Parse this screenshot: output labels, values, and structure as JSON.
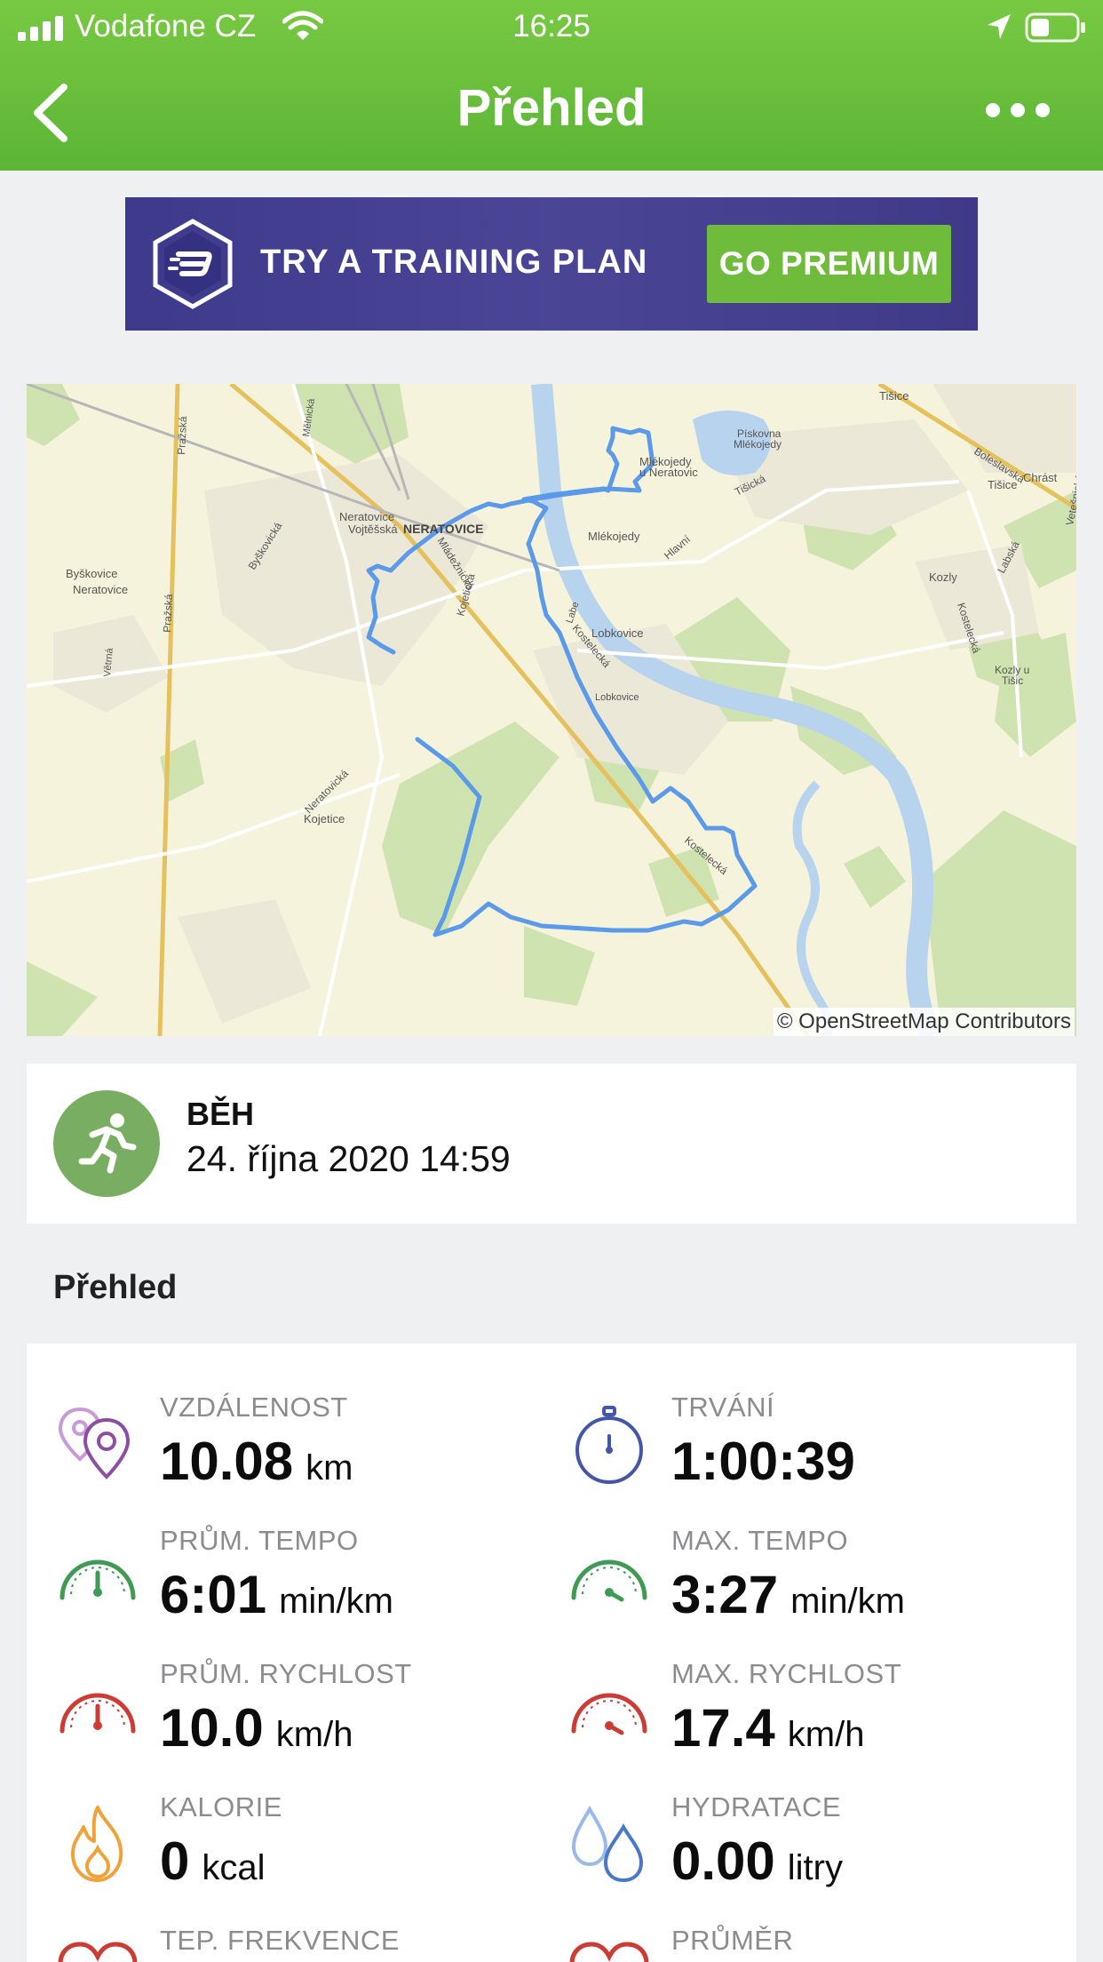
{
  "status_bar": {
    "carrier": "Vodafone CZ",
    "time": "16:25"
  },
  "nav": {
    "title": "Přehled"
  },
  "banner": {
    "text": "TRY A TRAINING PLAN",
    "button": "GO PREMIUM"
  },
  "map": {
    "attribution": "© OpenStreetMap Contributors",
    "labels": {
      "neratovice": "NERATOVICE",
      "neratovice_vojtesska": "Neratovice",
      "vojtesska": "Vojtěšská",
      "mlekojedy": "Mlékojedy",
      "mlekojedy_u_neratovic_1": "Mlékojedy",
      "mlekojedy_u_neratovic_2": "u Neratovic",
      "piskovna_1": "Pískovna",
      "piskovna_2": "Mlékojedy",
      "lobkovice": "Lobkovice",
      "lobkovice_small": "Lobkovice",
      "byskovice": "Byškovice",
      "byskovice_neratovice": "Neratovice",
      "kojetice": "Kojetice",
      "tisice_top": "Tišice",
      "tisice": "Tišice",
      "chrast": "Chrást",
      "kozly": "Kozly",
      "kozly_u_tisic_1": "Kozly u",
      "kozly_u_tisic_2": "Tišic",
      "prazska": "Pražská",
      "prazska_2": "Pražská",
      "neratovicka": "Neratovická",
      "bystricka": "Byškovická",
      "mladeznicka": "Mládežnická",
      "kojeticka": "Kojetická",
      "kostelecka": "Kostelecká",
      "kostelecka_2": "Kostelecká",
      "kostelecka_3": "Kostelecká",
      "labska": "Labská",
      "boleslavska": "Boleslavská",
      "tisicka": "Tišická",
      "hlavni": "Hlavní",
      "labe": "Labe",
      "vetesnicka": "Vetešnická",
      "vitrna": "Větrná",
      "melnicka": "Mělnická"
    }
  },
  "activity": {
    "type": "BĚH",
    "date": "24. října 2020 14:59",
    "icon": "running-person-icon",
    "color": "#79ae62"
  },
  "overview_title": "Přehled",
  "stats": [
    {
      "id": "distance",
      "label": "VZDÁLENOST",
      "value": "10.08",
      "unit": "km",
      "icon": "location-pins-icon",
      "color": "#8c4ea3"
    },
    {
      "id": "duration",
      "label": "TRVÁNÍ",
      "value": "1:00:39",
      "unit": "",
      "icon": "stopwatch-icon",
      "color": "#4456a8"
    },
    {
      "id": "avg_pace",
      "label": "PRŮM. TEMPO",
      "value": "6:01",
      "unit": "min/km",
      "icon": "speedometer-icon",
      "color": "#3f9a54"
    },
    {
      "id": "max_pace",
      "label": "MAX. TEMPO",
      "value": "3:27",
      "unit": "min/km",
      "icon": "speedometer-icon",
      "color": "#3f9a54"
    },
    {
      "id": "avg_speed",
      "label": "PRŮM. RYCHLOST",
      "value": "10.0",
      "unit": "km/h",
      "icon": "speedometer-icon",
      "color": "#cc3b34"
    },
    {
      "id": "max_speed",
      "label": "MAX. RYCHLOST",
      "value": "17.4",
      "unit": "km/h",
      "icon": "speedometer-icon",
      "color": "#cc3b34"
    },
    {
      "id": "calories",
      "label": "KALORIE",
      "value": "0",
      "unit": "kcal",
      "icon": "flame-icon",
      "color": "#f0a239"
    },
    {
      "id": "hydration",
      "label": "HYDRATACE",
      "value": "0.00",
      "unit": "litry",
      "icon": "water-drops-icon",
      "color": "#4a78c9"
    },
    {
      "id": "heart_rate",
      "label": "TEP. FREKVENCE",
      "value": "",
      "unit": "",
      "icon": "heart-icon",
      "color": "#cc3b34"
    },
    {
      "id": "average",
      "label": "PRŮMĚR",
      "value": "",
      "unit": "",
      "icon": "heart-icon",
      "color": "#cc3b34"
    }
  ]
}
